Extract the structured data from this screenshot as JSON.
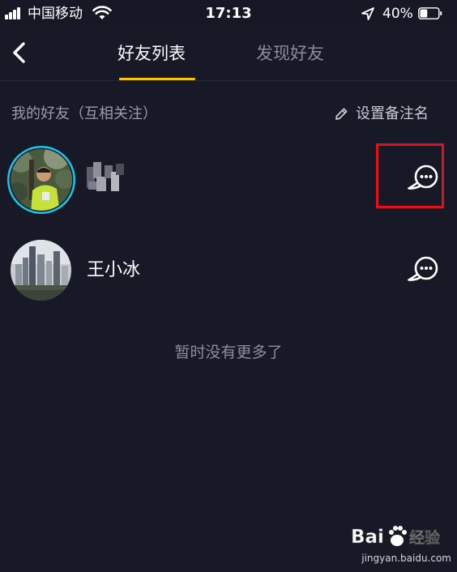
{
  "status_bar": {
    "carrier": "中国移动",
    "time": "17:13",
    "battery_percent": "40%",
    "battery_level": 0.4,
    "icons": [
      "signal-icon",
      "wifi-icon",
      "location-icon",
      "battery-icon"
    ]
  },
  "nav": {
    "back_icon": "chevron-left-icon",
    "tabs": [
      {
        "label": "好友列表",
        "active": true
      },
      {
        "label": "发现好友",
        "active": false
      }
    ],
    "accent_color": "#f9c314"
  },
  "section": {
    "title": "我的好友（互相关注）",
    "set_remark_label": "设置备注名",
    "set_remark_icon": "pencil-icon"
  },
  "friends": [
    {
      "name": "",
      "name_blurred": true,
      "avatar_ring": true,
      "action_icon": "chat-bubble-icon",
      "highlighted": true
    },
    {
      "name": "王小冰",
      "name_blurred": false,
      "avatar_ring": false,
      "action_icon": "chat-bubble-icon",
      "highlighted": false
    }
  ],
  "empty_hint": "暂时没有更多了",
  "watermark": {
    "logo_text": "Bai度经验",
    "url": "jingyan.baidu.com"
  },
  "colors": {
    "background": "#171a26",
    "highlight_border": "#e3101a",
    "avatar_ring": "#19c6ee"
  }
}
